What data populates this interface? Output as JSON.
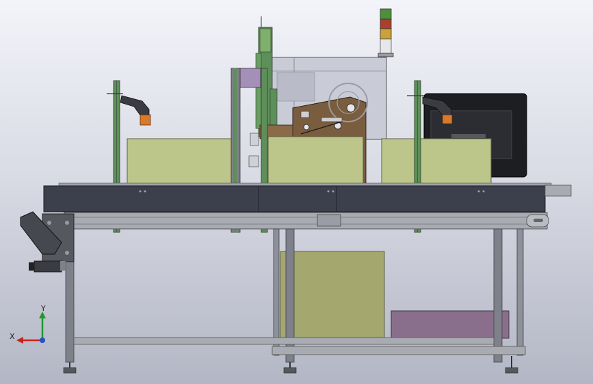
{
  "view": {
    "triad": {
      "x_label": "X",
      "y_label": "Y"
    }
  },
  "colors": {
    "box_green": "#bcc58a",
    "box_green_dark": "#9aa06a",
    "frame_gray": "#7e8189",
    "frame_light": "#a8abb2",
    "conveyor_dark": "#3c3f4c",
    "conveyor_mid": "#4c4f5e",
    "profile_green": "#5e8f5a",
    "bracket_purple": "#a48fb8",
    "machine_brown": "#7a5d3f",
    "panel_glass": "#c9cbd6",
    "monitor_black": "#1d1e22",
    "scanner_orange": "#d8792b",
    "tower_green": "#4f8f3c",
    "tower_red": "#a8402d",
    "tower_amber": "#c9a23b",
    "crate_purple": "#8a6f8c"
  },
  "parts": [
    "conveyor-belt",
    "conveyor-frame",
    "drive-motor",
    "drive-belt-guard",
    "barcode-scanner-left",
    "barcode-scanner-right",
    "label-printer-applicator",
    "signal-tower",
    "monitor",
    "product-box-left",
    "product-box-middle",
    "product-box-right",
    "lower-storage-box",
    "lower-crate",
    "leveling-feet"
  ]
}
